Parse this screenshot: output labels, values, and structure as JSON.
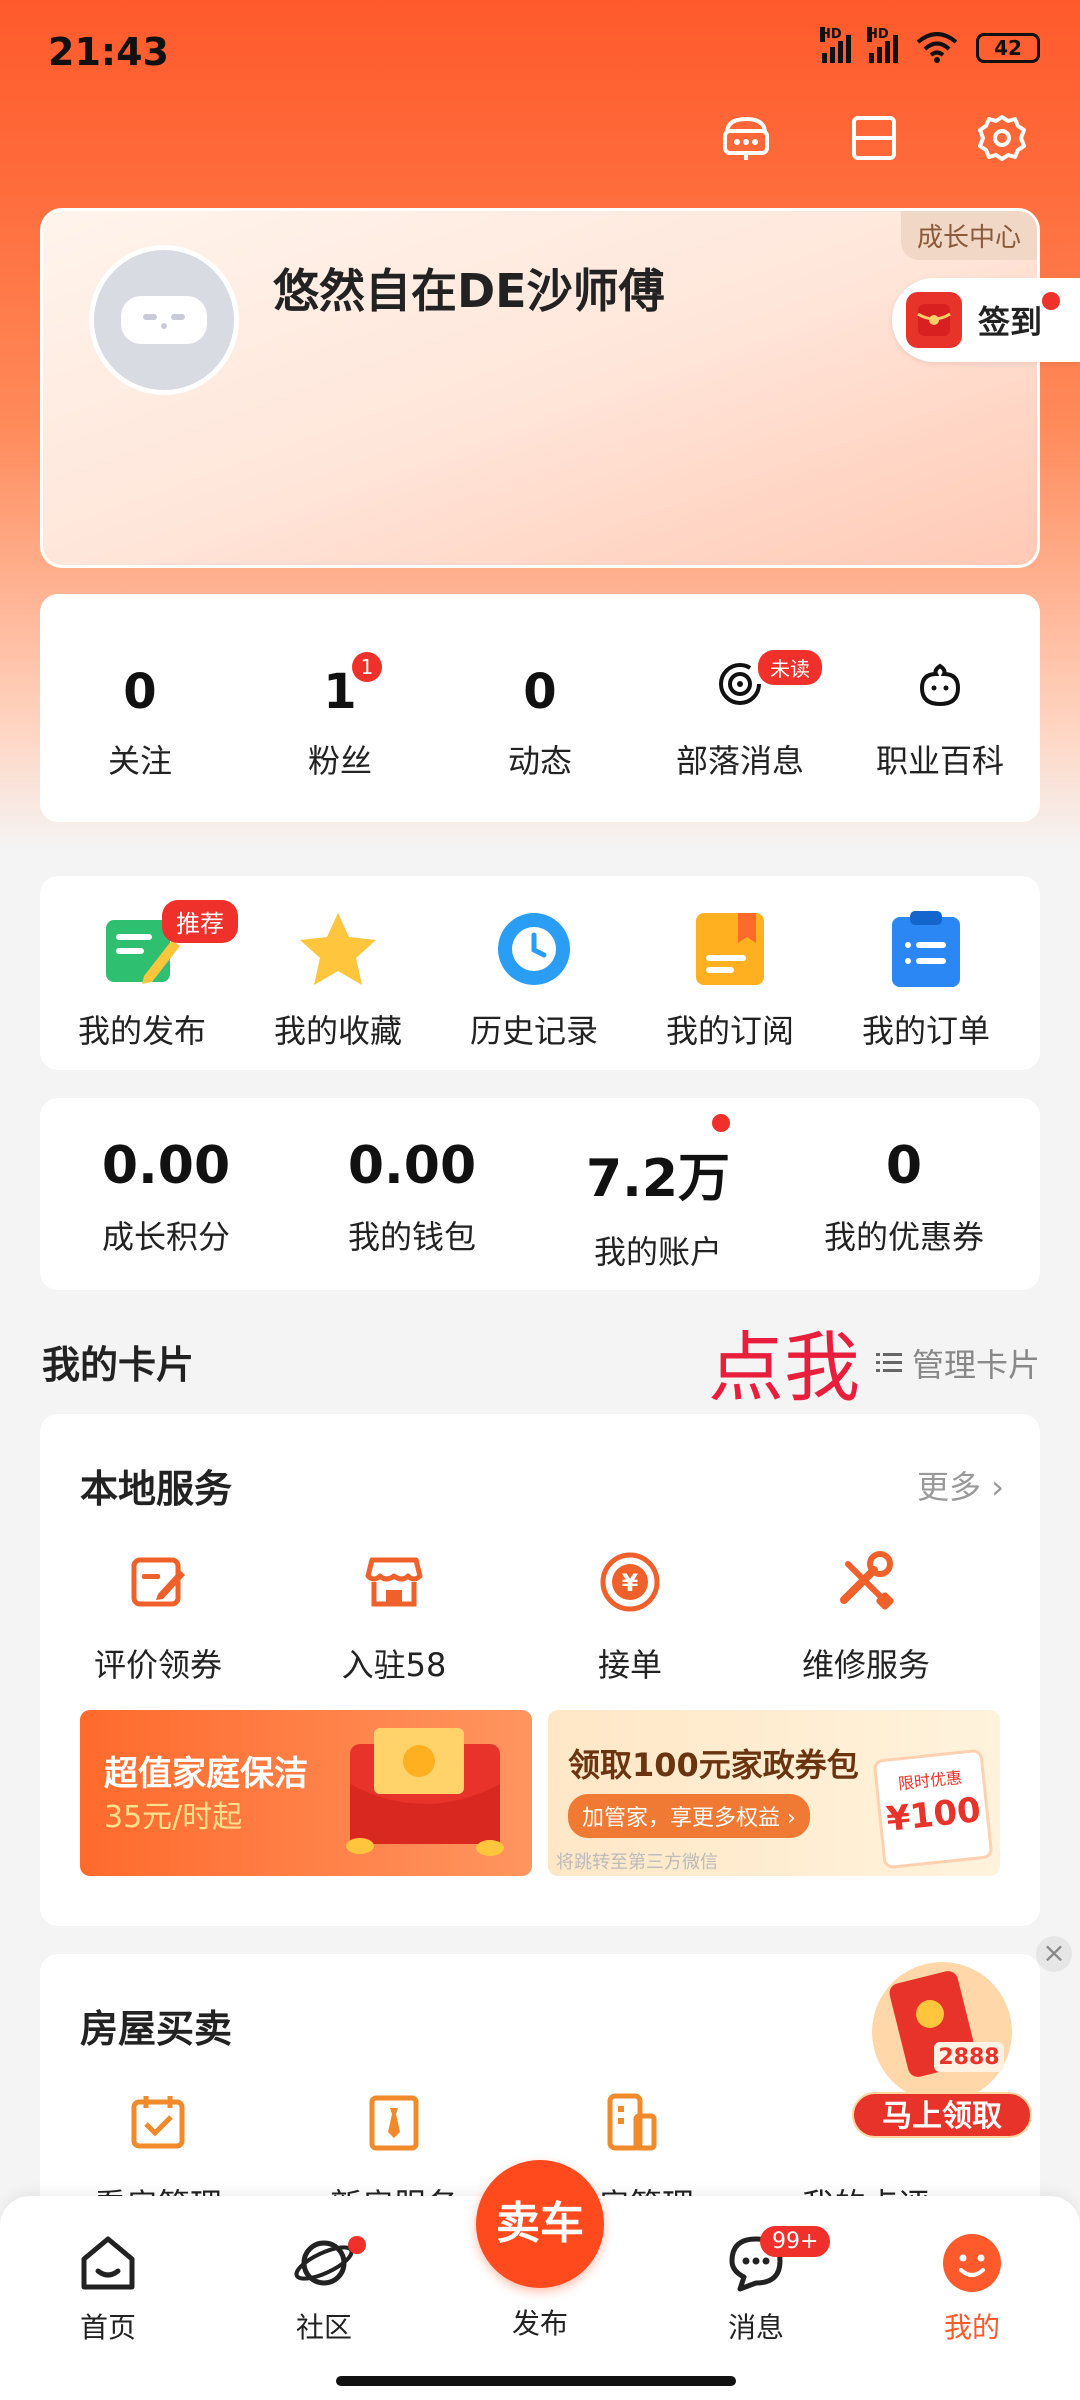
{
  "status_bar": {
    "time": "21:43",
    "network_1": "HD",
    "network_2": "HD",
    "battery": "42"
  },
  "profile": {
    "username": "悠然自在DE沙师傅",
    "growth_center": "成长中心",
    "signin_label": "签到"
  },
  "stats": [
    {
      "value": "0",
      "label": "关注"
    },
    {
      "value": "1",
      "label": "粉丝",
      "badge": "1"
    },
    {
      "value": "0",
      "label": "动态"
    },
    {
      "label": "部落消息",
      "badge": "未读"
    },
    {
      "label": "职业百科"
    }
  ],
  "menu": [
    {
      "label": "我的发布",
      "tag": "推荐"
    },
    {
      "label": "我的收藏"
    },
    {
      "label": "历史记录"
    },
    {
      "label": "我的订阅"
    },
    {
      "label": "我的订单"
    }
  ],
  "wallet": [
    {
      "value": "0.00",
      "label": "成长积分"
    },
    {
      "value": "0.00",
      "label": "我的钱包"
    },
    {
      "value": "7.2万",
      "label": "我的账户"
    },
    {
      "value": "0",
      "label": "我的优惠券"
    }
  ],
  "cards_section": {
    "title": "我的卡片",
    "annotation": "点我",
    "manage_label": "管理卡片"
  },
  "local_services": {
    "title": "本地服务",
    "more_label": "更多",
    "items": [
      "评价领券",
      "入驻58",
      "接单",
      "维修服务"
    ],
    "banner_1": {
      "title": "超值家庭保洁",
      "subtitle": "35元/时起"
    },
    "banner_2": {
      "title": "领取100元家政券包",
      "button": "加管家，享更多权益",
      "footnote": "将跳转至第三方微信",
      "coupon_tag": "限时优惠",
      "coupon_value": "¥100"
    }
  },
  "house_trading": {
    "title": "房屋买卖",
    "items": [
      "看房管理",
      "新房服务",
      "卖房管理",
      "我的点评"
    ]
  },
  "float_promo": {
    "button": "马上领取",
    "amount": "2888",
    "close": "×"
  },
  "tabbar": {
    "items": [
      {
        "label": "首页"
      },
      {
        "label": "社区"
      },
      {
        "label": "发布",
        "button": "卖车"
      },
      {
        "label": "消息",
        "badge": "99+"
      },
      {
        "label": "我的"
      }
    ]
  },
  "colors": {
    "accent": "#ff5a2c",
    "badge_red": "#f0302a",
    "annotation_red": "#e81e3c"
  }
}
